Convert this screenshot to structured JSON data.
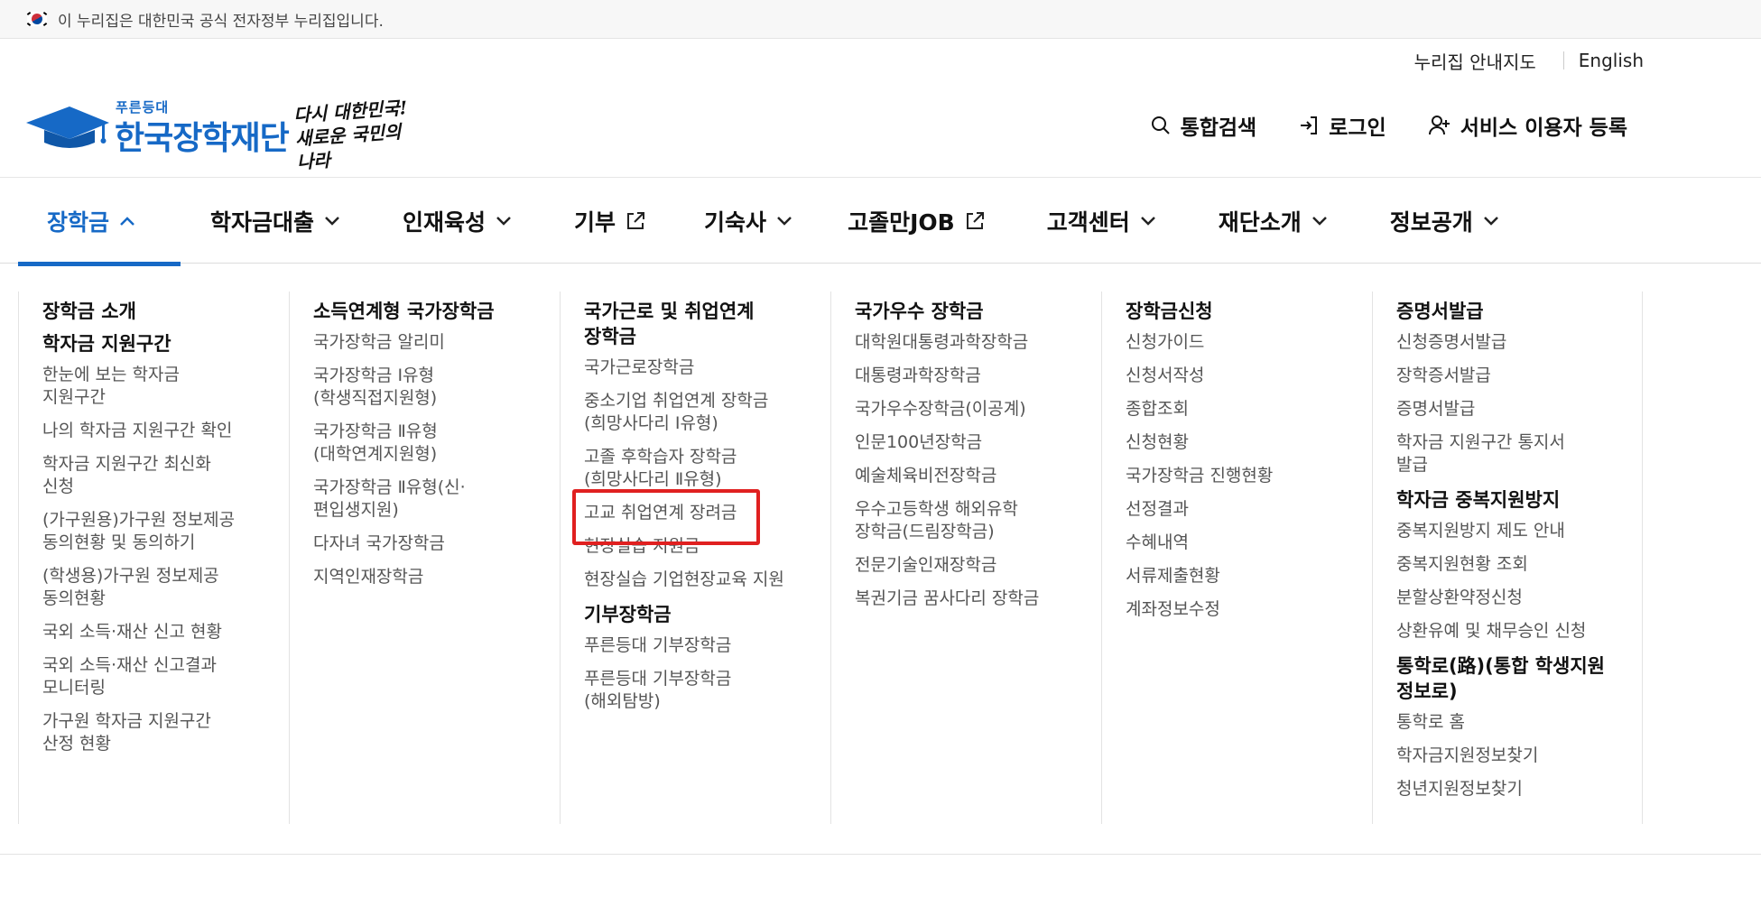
{
  "gov_banner": {
    "text": "이 누리집은 대한민국 공식 전자정부 누리집입니다."
  },
  "util_links": {
    "sitemap": "누리집 안내지도",
    "english": "English"
  },
  "logo": {
    "small": "푸른등대",
    "name": "한국장학재단",
    "slogan_line1": "다시 대한민국!",
    "slogan_line2": "새로운 국민의 나라"
  },
  "actions": {
    "search": "통합검색",
    "login": "로그인",
    "register": "서비스 이용자 등록"
  },
  "gnb": {
    "items": [
      {
        "label": "장학금",
        "icon": "chevron-up-icon",
        "active": true
      },
      {
        "label": "학자금대출",
        "icon": "chevron-down-icon"
      },
      {
        "label": "인재육성",
        "icon": "chevron-down-icon"
      },
      {
        "label": "기부",
        "icon": "external-link-icon"
      },
      {
        "label": "기숙사",
        "icon": "chevron-down-icon"
      },
      {
        "label": "고졸만JOB",
        "icon": "external-link-icon"
      },
      {
        "label": "고객센터",
        "icon": "chevron-down-icon"
      },
      {
        "label": "재단소개",
        "icon": "chevron-down-icon"
      },
      {
        "label": "정보공개",
        "icon": "chevron-down-icon"
      }
    ],
    "accent": "#1669c6"
  },
  "mega": {
    "col1": {
      "h1": "장학금 소개",
      "h2": "학자금 지원구간",
      "links": [
        "한눈에 보는 학자금\n지원구간",
        "나의 학자금 지원구간 확인",
        "학자금 지원구간 최신화\n신청",
        "(가구원용)가구원 정보제공\n동의현황 및 동의하기",
        "(학생용)가구원 정보제공\n동의현황",
        "국외 소득·재산 신고 현황",
        "국외 소득·재산 신고결과\n모니터링",
        "가구원 학자금 지원구간\n산정 현황"
      ]
    },
    "col2": {
      "h1": "소득연계형 국가장학금",
      "links": [
        "국가장학금 알리미",
        "국가장학금 Ⅰ유형\n(학생직접지원형)",
        "국가장학금 Ⅱ유형\n(대학연계지원형)",
        "국가장학금 Ⅱ유형(신·\n편입생지원)",
        "다자녀 국가장학금",
        "지역인재장학금"
      ]
    },
    "col3": {
      "h1": "국가근로 및 취업연계\n장학금",
      "links": [
        "국가근로장학금",
        "중소기업 취업연계 장학금\n(희망사다리 Ⅰ유형)",
        "고졸 후학습자 장학금\n(희망사다리 Ⅱ유형)",
        "고교 취업연계 장려금",
        "현장실습 지원금",
        "현장실습 기업현장교육 지원"
      ],
      "h2": "기부장학금",
      "links2": [
        "푸른등대 기부장학금",
        "푸른등대 기부장학금\n(해외탐방)"
      ]
    },
    "col4": {
      "h1": "국가우수 장학금",
      "links": [
        "대학원대통령과학장학금",
        "대통령과학장학금",
        "국가우수장학금(이공계)",
        "인문100년장학금",
        "예술체육비전장학금",
        "우수고등학생 해외유학\n장학금(드림장학금)",
        "전문기술인재장학금",
        "복권기금 꿈사다리 장학금"
      ]
    },
    "col5": {
      "h1": "장학금신청",
      "links": [
        "신청가이드",
        "신청서작성",
        "종합조회",
        "신청현황",
        "국가장학금 진행현황",
        "선정결과",
        "수혜내역",
        "서류제출현황",
        "계좌정보수정"
      ]
    },
    "col6": {
      "h1": "증명서발급",
      "links": [
        "신청증명서발급",
        "장학증서발급",
        "증명서발급",
        "학자금 지원구간 통지서\n발급"
      ],
      "h2": "학자금 중복지원방지",
      "links2": [
        "중복지원방지 제도 안내",
        "중복지원현황 조회",
        "분할상환약정신청",
        "상환유예 및 채무승인 신청"
      ],
      "h3": "통학로(路)(통합 학생지원\n정보로)",
      "links3": [
        "통학로 홈",
        "학자금지원정보찾기",
        "청년지원정보찾기"
      ]
    }
  },
  "highlight_color": "#e02020"
}
